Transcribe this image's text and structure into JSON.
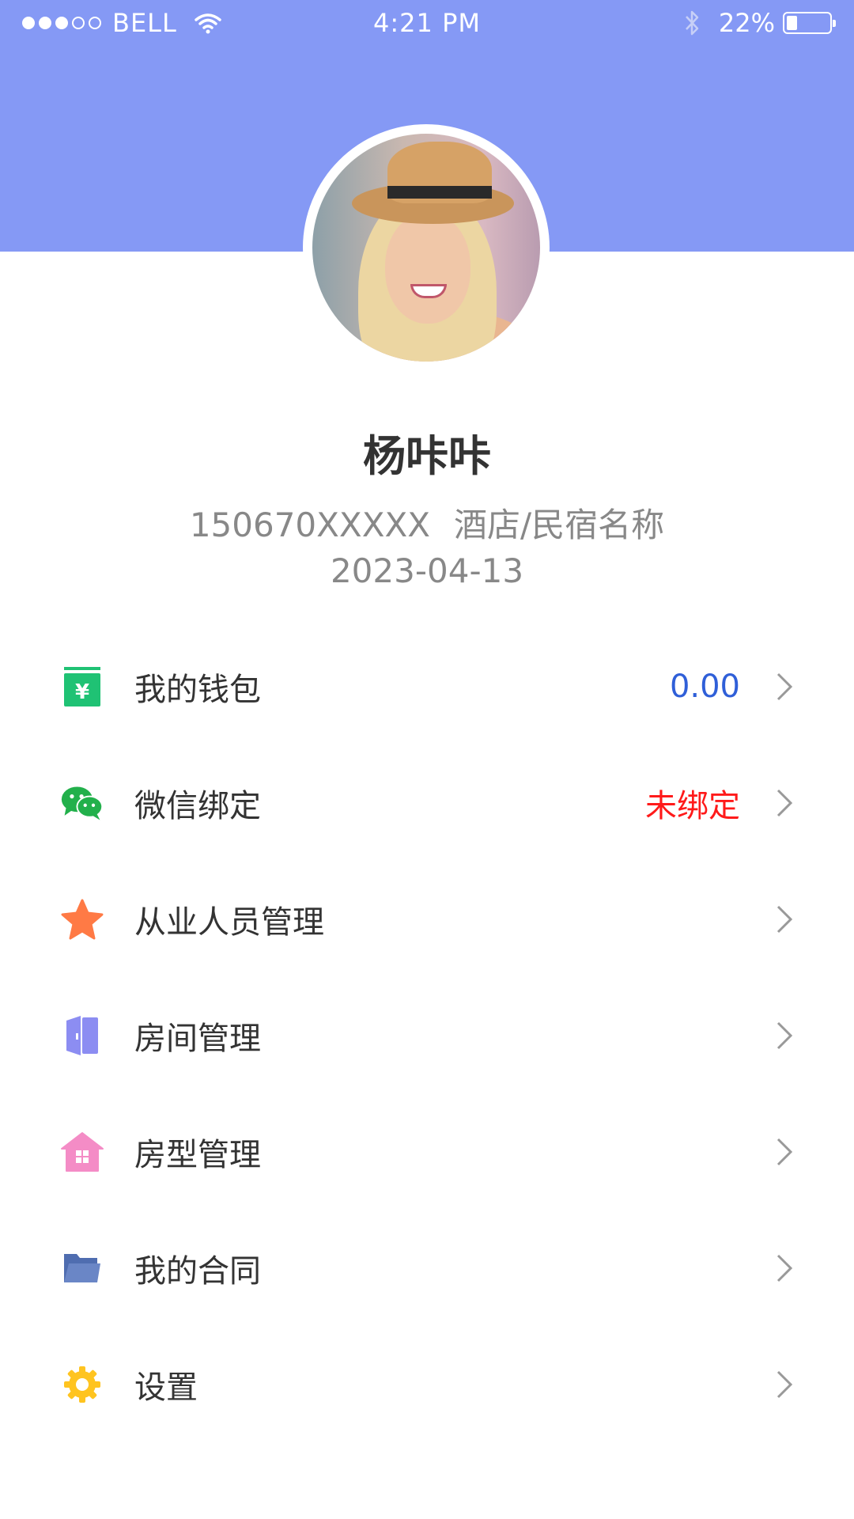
{
  "status_bar": {
    "carrier": "BELL",
    "time": "4:21 PM",
    "battery_percent": "22%",
    "signal_strength": 3,
    "signal_total": 5,
    "battery_level": 0.22
  },
  "profile": {
    "name": "杨咔咔",
    "phone": "150670XXXXX",
    "hotel": "酒店/民宿名称",
    "date": "2023-04-13"
  },
  "menu": [
    {
      "label": "我的钱包",
      "value": "0.00",
      "value_color": "#2f5fd8",
      "icon": "wallet-icon",
      "icon_color": "#1fc274"
    },
    {
      "label": "微信绑定",
      "value": "未绑定",
      "value_color": "#ff1a1a",
      "icon": "wechat-icon",
      "icon_color": "#22b04b"
    },
    {
      "label": "从业人员管理",
      "value": "",
      "icon": "star-icon",
      "icon_color": "#ff7a45"
    },
    {
      "label": "房间管理",
      "value": "",
      "icon": "door-icon",
      "icon_color": "#8c8df2"
    },
    {
      "label": "房型管理",
      "value": "",
      "icon": "house-icon",
      "icon_color": "#f48cc6"
    },
    {
      "label": "我的合同",
      "value": "",
      "icon": "folder-icon",
      "icon_color": "#6a86c6"
    },
    {
      "label": "设置",
      "value": "",
      "icon": "gear-icon",
      "icon_color": "#ffc420"
    }
  ],
  "colors": {
    "header": "#8599f5",
    "chevron": "#999999"
  }
}
